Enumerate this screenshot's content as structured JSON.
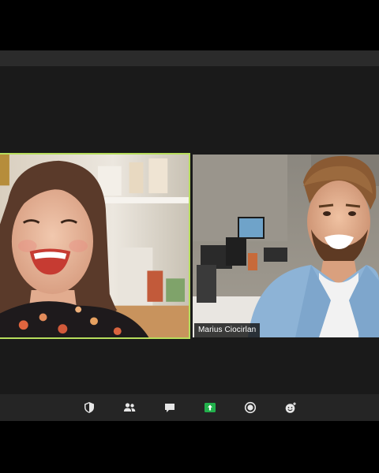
{
  "participants": [
    {
      "id": "left",
      "name": ""
    },
    {
      "id": "right",
      "name": "Marius Ciocirlan"
    }
  ],
  "toolbar": {
    "buttons": [
      {
        "icon": "security-shield-icon"
      },
      {
        "icon": "participants-icon"
      },
      {
        "icon": "chat-icon"
      },
      {
        "icon": "share-screen-icon"
      },
      {
        "icon": "record-icon"
      },
      {
        "icon": "reactions-icon"
      }
    ]
  },
  "colors": {
    "active_speaker_border": "#b7dd5c",
    "share_screen_green": "#22b14c",
    "toolbar_bg": "#252525",
    "stage_bg": "#1a1a1a"
  }
}
